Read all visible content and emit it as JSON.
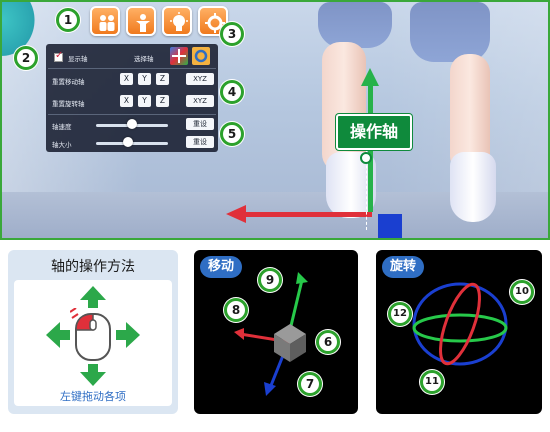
{
  "toolbar": {
    "buttons": [
      {
        "icon": "people-icon"
      },
      {
        "icon": "person-icon"
      },
      {
        "icon": "lightbulb-icon"
      },
      {
        "icon": "gear-icon"
      }
    ],
    "accent": "#f07a1e"
  },
  "panel": {
    "show_axis_label": "显示轴",
    "select_axis_label": "选择轴",
    "reset_move_axis_label": "重置移动轴",
    "reset_rotate_axis_label": "重置旋转轴",
    "axis_speed_label": "轴速度",
    "axis_size_label": "轴大小",
    "x": "X",
    "y": "Y",
    "z": "Z",
    "xyz": "XYZ",
    "reset": "重设",
    "show_axis_checked": true,
    "axis_speed_level": 0.5,
    "axis_size_level": 0.45
  },
  "callouts": {
    "c1": "1",
    "c2": "2",
    "c3": "3",
    "c4": "4",
    "c5": "5",
    "c6": "6",
    "c7": "7",
    "c8": "8",
    "c9": "9",
    "c10": "10",
    "c11": "11",
    "c12": "12"
  },
  "scene": {
    "axis_tag": "操作轴"
  },
  "howto": {
    "title": "轴的操作方法",
    "caption": "左键拖动各项"
  },
  "move": {
    "title": "移动"
  },
  "rotate": {
    "title": "旋转"
  },
  "colors": {
    "frame_green": "#2ca12c",
    "axis_x": "#e0303a",
    "axis_y": "#27b24a",
    "axis_z": "#1a3fd0",
    "pill_blue": "#2f6ec4"
  }
}
